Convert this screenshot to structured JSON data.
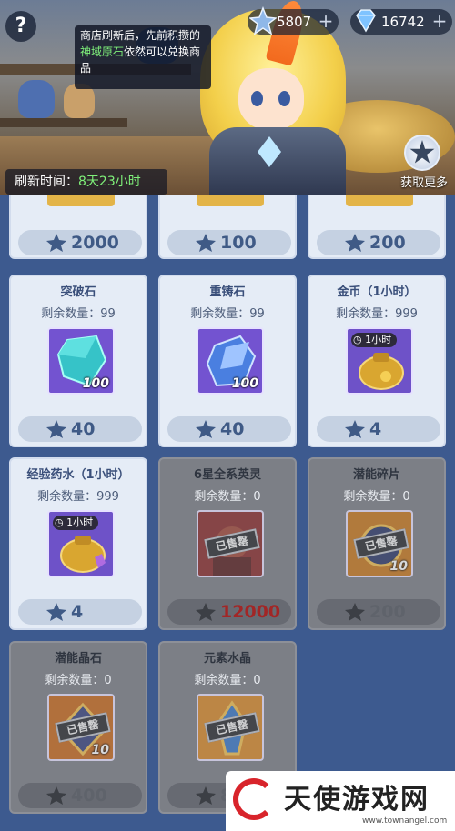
{
  "header": {
    "help_label": "?",
    "currency_1": {
      "value": "5807",
      "icon": "star-crystal-icon",
      "plus": "+"
    },
    "currency_2": {
      "value": "16742",
      "icon": "diamond-icon",
      "plus": "+"
    },
    "tooltip": {
      "pre": "商店刷新后，先前积攒的",
      "highlight": "神域原石",
      "post": "依然可以兑换商品"
    },
    "refresh": {
      "label": "刷新时间：",
      "time": "8天23小时"
    },
    "more_label": "获取更多"
  },
  "partial_cards": [
    {
      "price": "2000"
    },
    {
      "price": "100"
    },
    {
      "price": "200"
    }
  ],
  "cards": [
    {
      "name": "突破石",
      "remain_label": "剩余数量：",
      "remain": "99",
      "qty": "100",
      "price": "40",
      "sold": false,
      "icon": "crystal-teal"
    },
    {
      "name": "重铸石",
      "remain_label": "剩余数量：",
      "remain": "99",
      "qty": "100",
      "price": "40",
      "sold": false,
      "icon": "crystal-blue"
    },
    {
      "name": "金币（1小时）",
      "remain_label": "剩余数量：",
      "remain": "999",
      "qty": "",
      "tag": "1小时",
      "price": "4",
      "sold": false,
      "icon": "gold-bag"
    },
    {
      "name": "经验药水（1小时）",
      "remain_label": "剩余数量：",
      "remain": "999",
      "qty": "",
      "tag": "1小时",
      "price": "4",
      "sold": false,
      "icon": "exp-bag"
    },
    {
      "name": "6星全系英灵",
      "remain_label": "剩余数量：",
      "remain": "0",
      "qty": "",
      "price": "12000",
      "sold": true,
      "sold_text": "已售罄",
      "icon": "hero-portrait"
    },
    {
      "name": "潜能碎片",
      "remain_label": "剩余数量：",
      "remain": "0",
      "qty": "10",
      "price": "200",
      "sold": true,
      "sold_text": "已售罄",
      "icon": "potential-shard"
    },
    {
      "name": "潜能晶石",
      "remain_label": "剩余数量：",
      "remain": "0",
      "qty": "10",
      "price": "400",
      "sold": true,
      "sold_text": "已售罄",
      "icon": "potential-stone"
    },
    {
      "name": "元素水晶",
      "remain_label": "剩余数量：",
      "remain": "0",
      "qty": "",
      "price": "8",
      "sold": true,
      "sold_text": "已售罄",
      "icon": "element-crystal"
    }
  ],
  "watermark": {
    "text": "天使游戏网",
    "url": "www.townangel.com"
  }
}
